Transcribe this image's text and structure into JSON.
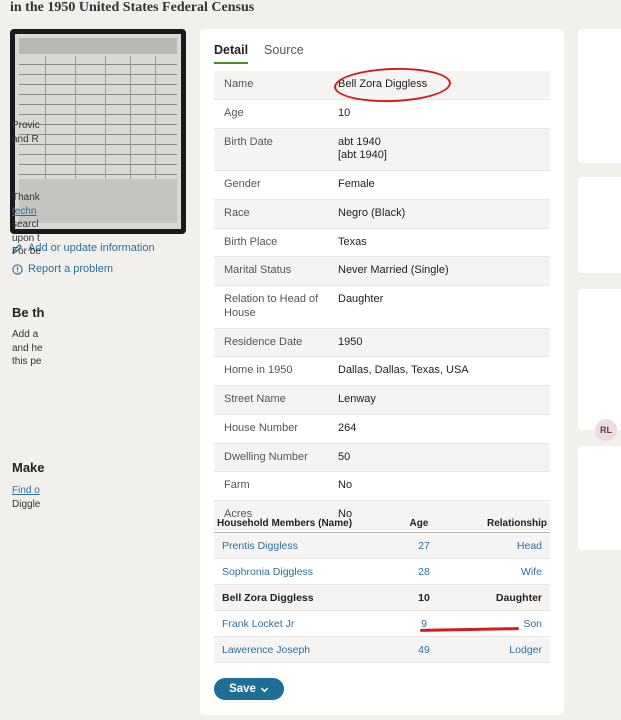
{
  "page": {
    "heading": "in the 1950 United States Federal Census"
  },
  "left": {
    "add_update": "Add or update information",
    "report": "Report a problem"
  },
  "tabs": [
    {
      "label": "Detail"
    },
    {
      "label": "Source"
    }
  ],
  "details": [
    {
      "label": "Name",
      "value": "Bell Zora Diggless"
    },
    {
      "label": "Age",
      "value": "10"
    },
    {
      "label": "Birth Date",
      "value": "abt 1940",
      "value2": "[abt 1940]"
    },
    {
      "label": "Gender",
      "value": "Female"
    },
    {
      "label": "Race",
      "value": "Negro (Black)"
    },
    {
      "label": "Birth Place",
      "value": "Texas"
    },
    {
      "label": "Marital Status",
      "value": "Never Married (Single)"
    },
    {
      "label": "Relation to Head of House",
      "value": "Daughter"
    },
    {
      "label": "Residence Date",
      "value": "1950"
    },
    {
      "label": "Home in 1950",
      "value": "Dallas, Dallas, Texas, USA"
    },
    {
      "label": "Street Name",
      "value": "Lenway"
    },
    {
      "label": "House Number",
      "value": "264"
    },
    {
      "label": "Dwelling Number",
      "value": "50"
    },
    {
      "label": "Farm",
      "value": "No"
    },
    {
      "label": "Acres",
      "value": "No"
    }
  ],
  "household": {
    "headers": {
      "name": "Household Members (Name)",
      "age": "Age",
      "relationship": "Relationship"
    },
    "members": [
      {
        "name": "Prentis Diggless",
        "age": "27",
        "relationship": "Head"
      },
      {
        "name": "Sophronia Diggless",
        "age": "28",
        "relationship": "Wife"
      },
      {
        "name": "Bell Zora Diggless",
        "age": "10",
        "relationship": "Daughter"
      },
      {
        "name": "Frank Locket Jr",
        "age": "9",
        "relationship": "Son"
      },
      {
        "name": "Lawerence Joseph",
        "age": "49",
        "relationship": "Lodger"
      }
    ]
  },
  "save_label": "Save",
  "right": {
    "card1": {
      "line1": "Provic",
      "line2": "and R"
    },
    "card2": {
      "line1": "Thank",
      "link": "techn",
      "line3": "searcl",
      "line4": "upon t",
      "line5": "For be"
    },
    "card3": {
      "title": "Be th",
      "line1": "Add a",
      "line2": "and he",
      "line3": "this pe",
      "avatar": "RL"
    },
    "card4": {
      "title": "Make",
      "link": "Find o",
      "line2": "Diggle"
    }
  },
  "colors": {
    "accent": "#1d6f95",
    "link": "#2a6f9e",
    "annotation": "#d21d1d",
    "tab_underline": "#4a8a2a"
  }
}
